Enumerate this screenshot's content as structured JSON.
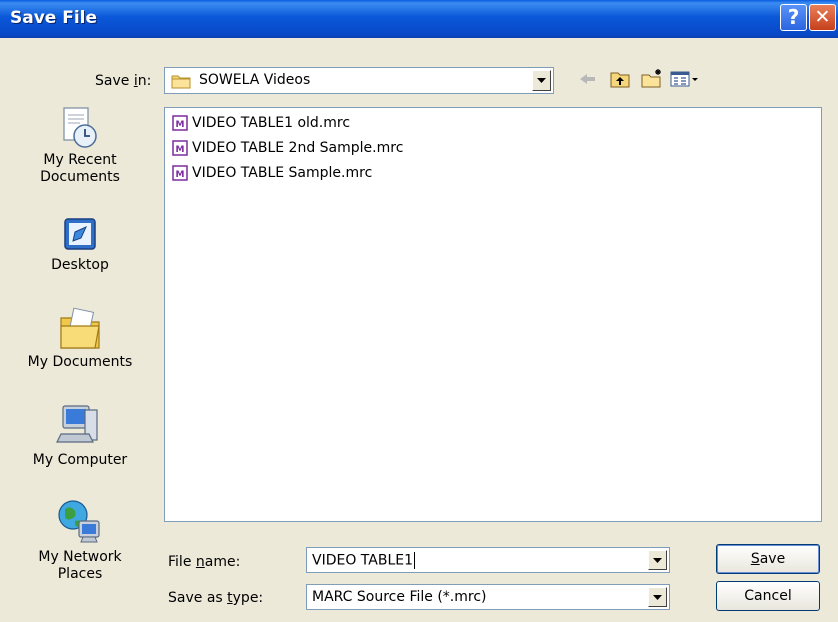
{
  "window": {
    "title": "Save File"
  },
  "save_in": {
    "label_pre": "Save ",
    "label_key": "i",
    "label_post": "n:",
    "folder": "SOWELA Videos"
  },
  "places": [
    {
      "label1": "My Recent",
      "label2": "Documents",
      "icon": "recent-documents-icon"
    },
    {
      "label1": "Desktop",
      "label2": "",
      "icon": "desktop-icon"
    },
    {
      "label1": "My Documents",
      "label2": "",
      "icon": "my-documents-icon"
    },
    {
      "label1": "My Computer",
      "label2": "",
      "icon": "my-computer-icon"
    },
    {
      "label1": "My Network",
      "label2": "Places",
      "icon": "network-places-icon"
    }
  ],
  "files": [
    {
      "name": "VIDEO TABLE1 old.mrc"
    },
    {
      "name": "VIDEO TABLE 2nd Sample.mrc"
    },
    {
      "name": "VIDEO TABLE Sample.mrc"
    }
  ],
  "file_name": {
    "label_pre": "File ",
    "label_key": "n",
    "label_post": "ame:",
    "value": "VIDEO TABLE1"
  },
  "save_as_type": {
    "label_pre": "Save as ",
    "label_key": "t",
    "label_post": "ype:",
    "value": "MARC Source File (*.mrc)"
  },
  "buttons": {
    "save_key": "S",
    "save_rest": "ave",
    "cancel": "Cancel"
  },
  "colors": {
    "titlebar": "#0a58d8",
    "dialog_bg": "#ece9d8",
    "file_icon": "#7b2c9e"
  }
}
